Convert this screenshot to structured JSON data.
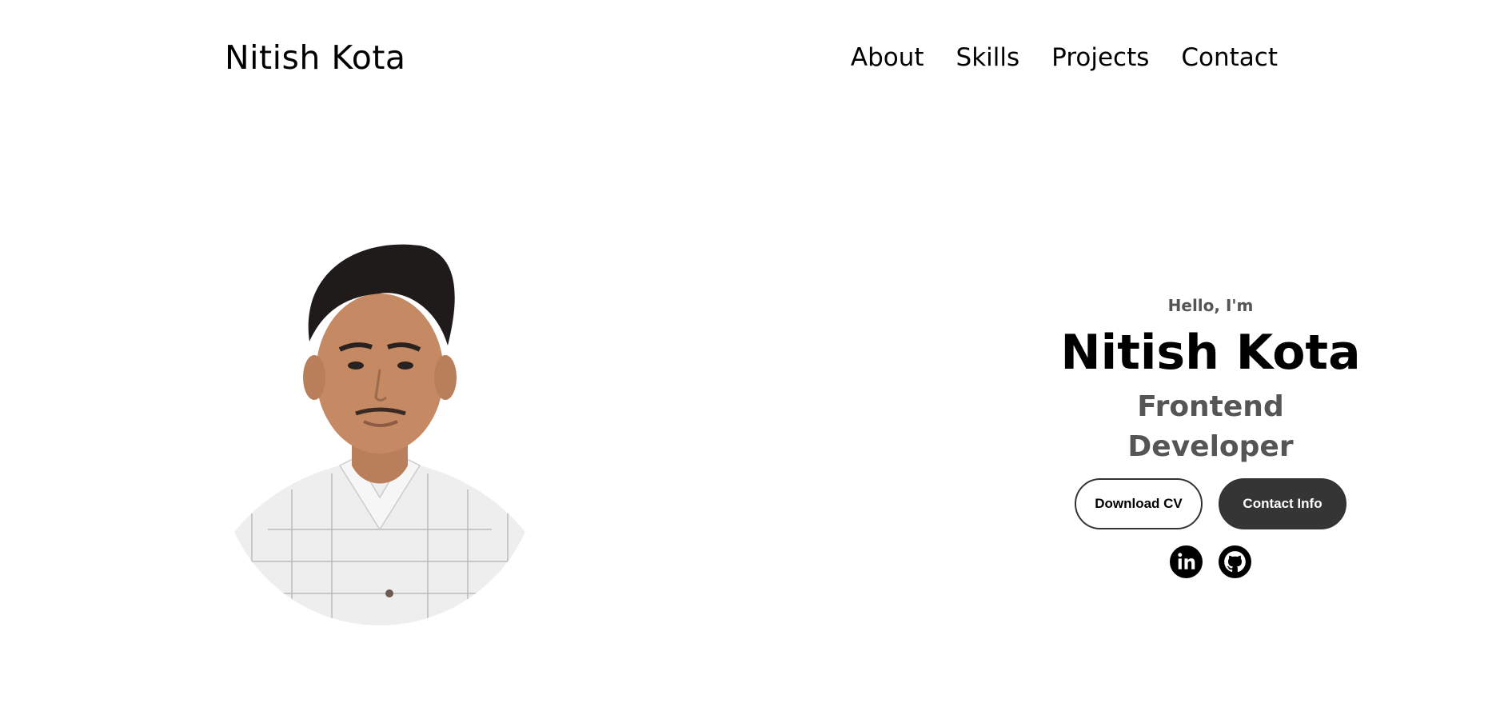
{
  "header": {
    "logo": "Nitish Kota",
    "nav": [
      "About",
      "Skills",
      "Projects",
      "Contact"
    ]
  },
  "hero": {
    "greeting": "Hello, I'm",
    "name": "Nitish Kota",
    "title": "Frontend Developer",
    "buttons": {
      "download_cv": "Download CV",
      "contact_info": "Contact Info"
    },
    "socials": [
      "linkedin-icon",
      "github-icon"
    ]
  },
  "colors": {
    "text": "#000000",
    "muted": "#555555",
    "button_dark": "#353535",
    "background": "#ffffff"
  }
}
